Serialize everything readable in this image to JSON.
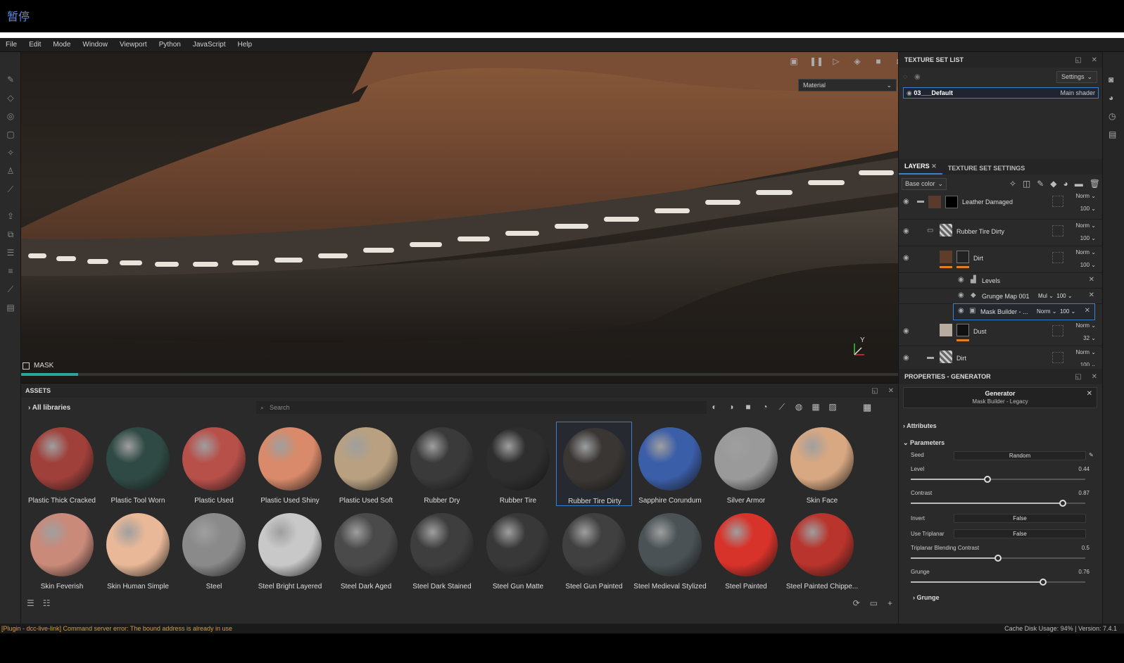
{
  "overlay": {
    "pause_label": "暂停"
  },
  "menu": [
    "File",
    "Edit",
    "Mode",
    "Window",
    "Viewport",
    "Python",
    "JavaScript",
    "Help"
  ],
  "viewport": {
    "display_mode": "Material",
    "mask_label": "MASK",
    "mask_progress_pct": 6.5,
    "axis_label": "Y"
  },
  "assets": {
    "title": "ASSETS",
    "library": "All libraries",
    "search_placeholder": "Search",
    "items": [
      {
        "name": "Plastic Thick Cracked",
        "color": "#a0403a"
      },
      {
        "name": "Plastic Tool Worn",
        "color": "#2f4a44"
      },
      {
        "name": "Plastic Used",
        "color": "#b8504a"
      },
      {
        "name": "Plastic Used Shiny",
        "color": "#d88a6a"
      },
      {
        "name": "Plastic Used Soft",
        "color": "#b8a080"
      },
      {
        "name": "Rubber Dry",
        "color": "#3a3a3a"
      },
      {
        "name": "Rubber Tire",
        "color": "#2e2e2e"
      },
      {
        "name": "Rubber Tire Dirty",
        "color": "#3a3634"
      },
      {
        "name": "Sapphire Corundum",
        "color": "#3b5ea8"
      },
      {
        "name": "Silver Armor",
        "color": "#9a9a9a"
      },
      {
        "name": "Skin Face",
        "color": "#d8a882"
      },
      {
        "name": "Skin Feverish",
        "color": "#c98a7a"
      },
      {
        "name": "Skin Human Simple",
        "color": "#e8b898"
      },
      {
        "name": "Steel",
        "color": "#8a8a8a"
      },
      {
        "name": "Steel Bright Layered",
        "color": "#c8c8c8"
      },
      {
        "name": "Steel Dark Aged",
        "color": "#4a4a4a"
      },
      {
        "name": "Steel Dark Stained",
        "color": "#3e3e3e"
      },
      {
        "name": "Steel Gun Matte",
        "color": "#383838"
      },
      {
        "name": "Steel Gun Painted",
        "color": "#404040"
      },
      {
        "name": "Steel Medieval Stylized",
        "color": "#4a5255"
      },
      {
        "name": "Steel Painted",
        "color": "#d8332a"
      },
      {
        "name": "Steel Painted Chippe...",
        "color": "#b8342c"
      }
    ],
    "selected_index": 7
  },
  "status": {
    "error": "[Plugin - dcc-live-link] Command server error: The bound address is already in use",
    "info": "Cache Disk Usage:   94% | Version: 7.4.1"
  },
  "texture_set_list": {
    "title": "TEXTURE SET LIST",
    "settings_label": "Settings",
    "set_name": "03___Default",
    "shader": "Main shader"
  },
  "layers_panel": {
    "tabs": [
      "LAYERS",
      "TEXTURE SET SETTINGS"
    ],
    "channel": "Base color",
    "layers": [
      {
        "name": "Leather Damaged",
        "blend": "Norm",
        "opacity": "100"
      },
      {
        "name": "Rubber Tire Dirty",
        "blend": "Norm",
        "opacity": "100"
      },
      {
        "name": "Dirt",
        "blend": "Norm",
        "opacity": "100"
      },
      {
        "name": "Levels"
      },
      {
        "name": "Grunge Map 001",
        "blend": "Mul",
        "opacity": "100"
      },
      {
        "name": "Mask Builder - ...",
        "blend": "Norm",
        "opacity": "100"
      },
      {
        "name": "Dust",
        "blend": "Norm",
        "opacity": "32"
      },
      {
        "name": "Dirt",
        "blend": "Norm",
        "opacity": "100"
      }
    ]
  },
  "properties": {
    "title": "PROPERTIES - GENERATOR",
    "generator_title": "Generator",
    "generator_name": "Mask Builder - Legacy",
    "sections": [
      "Attributes",
      "Parameters",
      "Grunge"
    ],
    "seed": {
      "label": "Seed",
      "value": "Random"
    },
    "level": {
      "label": "Level",
      "value": "0.44",
      "num": 0.44
    },
    "contrast": {
      "label": "Contrast",
      "value": "0.87",
      "num": 0.87
    },
    "invert": {
      "label": "Invert",
      "value": "False"
    },
    "triplanar": {
      "label": "Use Triplanar",
      "value": "False"
    },
    "tri_contrast": {
      "label": "Triplanar Blending Contrast",
      "value": "0.5",
      "num": 0.5
    },
    "grunge": {
      "label": "Grunge",
      "value": "0.76",
      "num": 0.76
    }
  },
  "icons": {
    "viewport_toolbar": [
      "screen-icon",
      "pause-icon",
      "camera-frame-icon",
      "cube-icon",
      "video-icon",
      "screenshot-icon"
    ],
    "left_tools": [
      "brush-icon",
      "eraser-icon",
      "projection-icon",
      "polygon-fill-icon",
      "smudge-icon",
      "clone-icon",
      "picker-icon",
      "export-icon",
      "bake-icon",
      "shelf-icon",
      "layers-icon",
      "paint-icon",
      "doc-icon"
    ]
  }
}
